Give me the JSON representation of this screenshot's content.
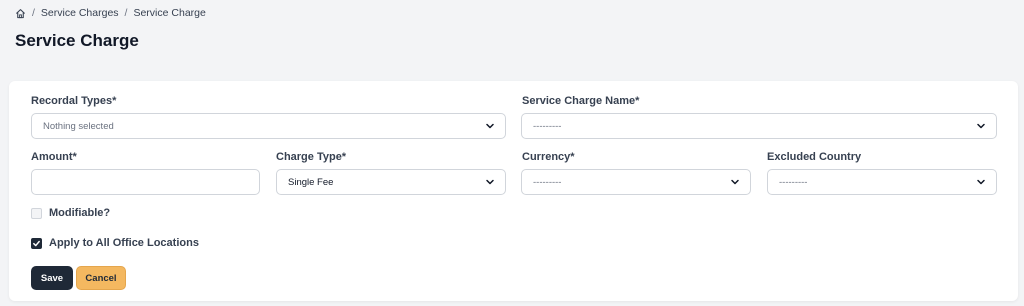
{
  "breadcrumb": {
    "items": [
      "Service Charges",
      "Service Charge"
    ],
    "separator": "/"
  },
  "page_title": "Service Charge",
  "form": {
    "recordal_types": {
      "label": "Recordal Types*",
      "value": "Nothing selected"
    },
    "service_charge_name": {
      "label": "Service Charge Name*",
      "value": "---------"
    },
    "amount": {
      "label": "Amount*",
      "value": ""
    },
    "charge_type": {
      "label": "Charge Type*",
      "value": "Single Fee"
    },
    "currency": {
      "label": "Currency*",
      "value": "---------"
    },
    "excluded_country": {
      "label": "Excluded Country",
      "value": "---------"
    },
    "modifiable": {
      "label": "Modifiable?",
      "checked": false
    },
    "apply_all": {
      "label": "Apply to All Office Locations",
      "checked": true
    }
  },
  "buttons": {
    "save": "Save",
    "cancel": "Cancel"
  },
  "colors": {
    "primary": "#1f2937",
    "cancel": "#f4b860",
    "background": "#f3f4f6"
  }
}
